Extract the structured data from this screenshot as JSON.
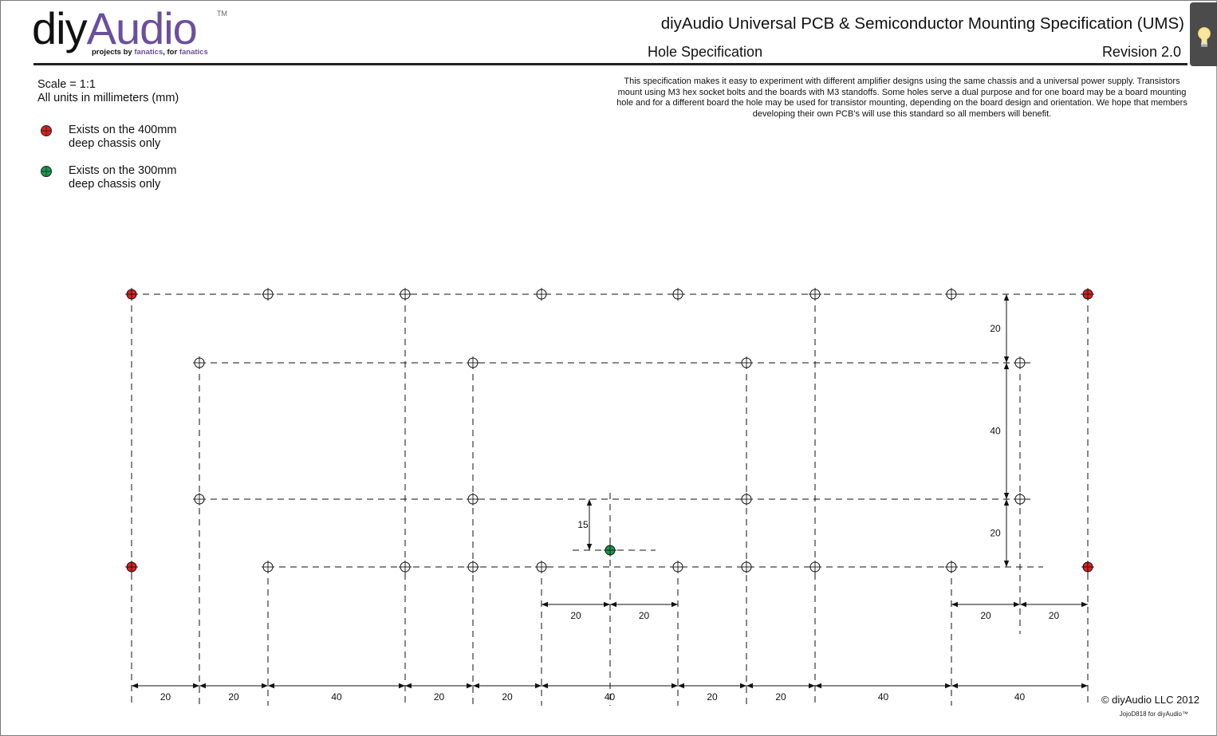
{
  "header": {
    "logo_main": "diy",
    "logo_accent": "Audio",
    "logo_tm": "TM",
    "tagline_1": "projects by ",
    "tagline_2": "fanatics",
    "tagline_3": ", for ",
    "tagline_4": "fanatics",
    "title": "diyAudio Universal PCB & Semiconductor Mounting Specification (UMS)",
    "subtitle": "Hole Specification",
    "revision": "Revision 2.0"
  },
  "info": {
    "scale": "Scale = 1:1",
    "units": "All units in millimeters (mm)"
  },
  "legend": [
    {
      "text": "Exists on the 400mm deep chassis only",
      "color": "#e02020"
    },
    {
      "text": "Exists on the 300mm deep chassis only",
      "color": "#1a9a4a"
    }
  ],
  "description": "This specification makes it easy to experiment with different amplifier designs using the same chassis and a universal power supply. Transistors mount using M3 hex socket bolts and the boards with M3 standoffs. Some holes serve a dual purpose and for one board may be a board mounting hole and for a different board the hole may be used for transistor mounting, depending on the board design and orientation. We hope that members developing their own PCB's will use this standard so all members will benefit.",
  "dimensions": {
    "bottom_row": [
      "20",
      "20",
      "40",
      "20",
      "20",
      "40",
      "20",
      "20",
      "40",
      "40"
    ],
    "right_vertical": [
      "20",
      "40",
      "20"
    ],
    "green_offset": "15",
    "green_horizontal": [
      "20",
      "20"
    ],
    "right_horizontal": [
      "20",
      "20"
    ]
  },
  "footer": {
    "copyright": "© diyAudio LLC 2012",
    "credit": "JojoD818 for diyAudio™"
  },
  "colors": {
    "red_hole": "#e02020",
    "green_hole": "#1a9a4a",
    "logo_purple": "#6b4f9e"
  }
}
